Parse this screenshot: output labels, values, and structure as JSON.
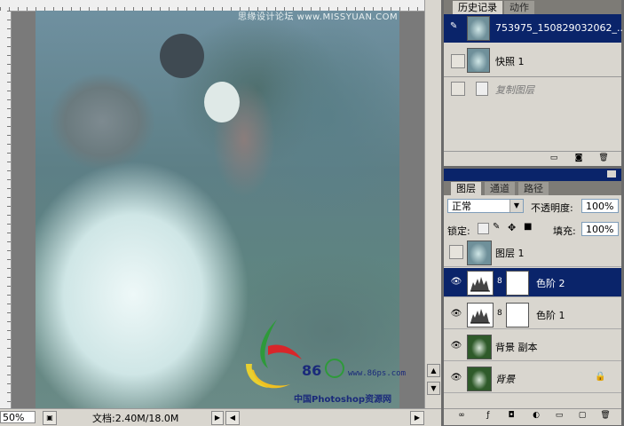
{
  "canvas": {
    "watermark_top": "思缘设计论坛 www.MISSYUAN.COM",
    "logo_number": "86",
    "logo_url": "www.86ps.com",
    "logo_cn": "中国Photoshop资源网",
    "zoom": "50%",
    "doc_info": "文档:2.40M/18.0M"
  },
  "history_panel": {
    "tabs": [
      "历史记录",
      "动作"
    ],
    "items": [
      {
        "label": "753975_150829032062_...",
        "selected": true
      },
      {
        "label": "快照 1",
        "selected": false
      },
      {
        "label": "复制图层",
        "selected": false
      }
    ]
  },
  "layers_panel": {
    "tabs": [
      "图层",
      "通道",
      "路径"
    ],
    "blend_mode": "正常",
    "opacity_label": "不透明度:",
    "opacity_value": "100%",
    "lock_label": "锁定:",
    "fill_label": "填充:",
    "fill_value": "100%",
    "layers": [
      {
        "name": "图层 1",
        "visible": false,
        "selected": false
      },
      {
        "name": "色阶 2",
        "visible": true,
        "selected": true
      },
      {
        "name": "色阶 1",
        "visible": true,
        "selected": false
      },
      {
        "name": "背景 副本",
        "visible": true,
        "selected": false
      },
      {
        "name": "背景",
        "visible": true,
        "selected": false,
        "locked": true
      }
    ]
  }
}
